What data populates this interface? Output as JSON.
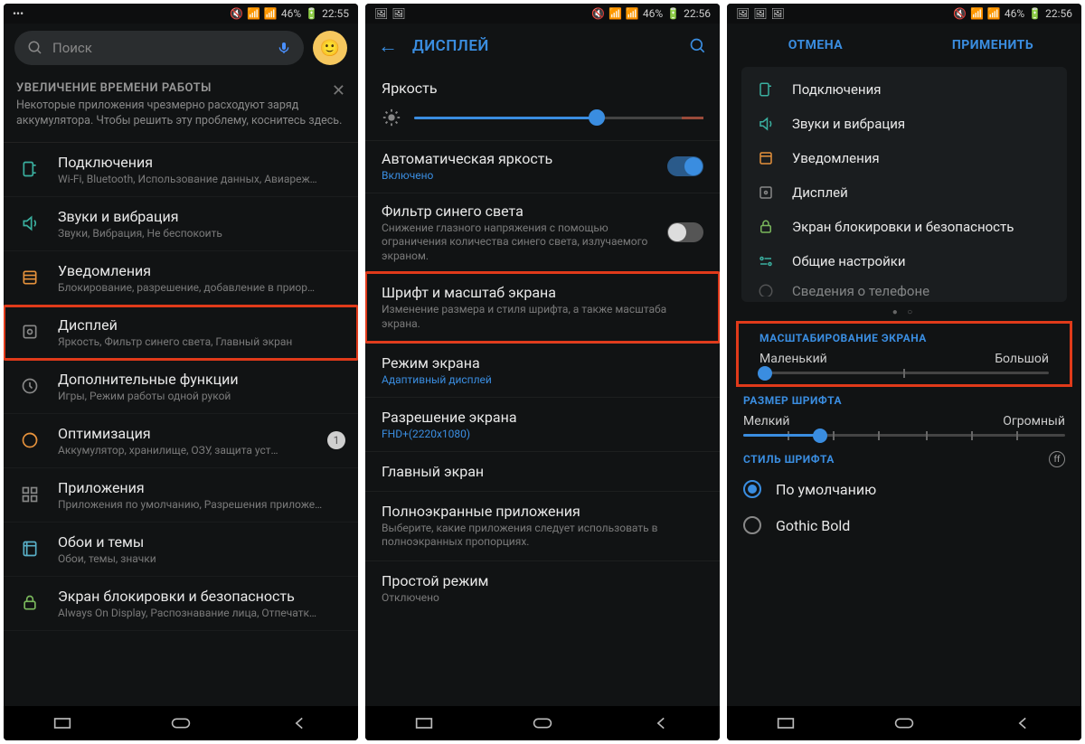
{
  "screen1": {
    "status": {
      "time": "22:55",
      "battery": "46%"
    },
    "search": {
      "placeholder": "Поиск"
    },
    "banner": {
      "title": "УВЕЛИЧЕНИЕ ВРЕМЕНИ РАБОТЫ",
      "text": "Некоторые приложения чрезмерно расходуют заряд аккумулятора. Чтобы решить эту проблему, коснитесь здесь."
    },
    "items": [
      {
        "title": "Подключения",
        "sub": "Wi-Fi, Bluetooth, Использование данных, Авиареж…"
      },
      {
        "title": "Звуки и вибрация",
        "sub": "Звуки, Вибрация, Не беспокоить"
      },
      {
        "title": "Уведомления",
        "sub": "Блокирование, разрешение, добавление в приор…"
      },
      {
        "title": "Дисплей",
        "sub": "Яркость, Фильтр синего света, Главный экран"
      },
      {
        "title": "Дополнительные функции",
        "sub": "Игры, Режим работы одной рукой"
      },
      {
        "title": "Оптимизация",
        "sub": "Аккумулятор, хранилище, ОЗУ, защита уст…",
        "badge": "1"
      },
      {
        "title": "Приложения",
        "sub": "Приложения по умолчанию, Разрешения приложе…"
      },
      {
        "title": "Обои и темы",
        "sub": "Обои, темы, значки"
      },
      {
        "title": "Экран блокировки и безопасность",
        "sub": "Always On Display, Распознавание лица, Отпечатк…"
      }
    ]
  },
  "screen2": {
    "status": {
      "time": "22:56",
      "battery": "46%"
    },
    "header": {
      "title": "ДИСПЛЕЙ"
    },
    "brightness": {
      "label": "Яркость",
      "value": 63
    },
    "rows": [
      {
        "title": "Автоматическая яркость",
        "sub": "Включено",
        "toggle": true,
        "link": true
      },
      {
        "title": "Фильтр синего света",
        "sub": "Снижение глазного напряжения с помощью ограничения количества синего света, излучаемого экраном.",
        "toggle": false
      },
      {
        "title": "Шрифт и масштаб экрана",
        "sub": "Изменение размера и стиля шрифта, а также масштаба экрана."
      },
      {
        "title": "Режим экрана",
        "sub": "Адаптивный дисплей",
        "link": true
      },
      {
        "title": "Разрешение экрана",
        "sub": "FHD+(2220x1080)",
        "link": true
      },
      {
        "title": "Главный экран"
      },
      {
        "title": "Полноэкранные приложения",
        "sub": "Выберите, какие приложения следует использовать в полноэкранных пропорциях."
      },
      {
        "title": "Простой режим",
        "sub": "Отключено"
      }
    ]
  },
  "screen3": {
    "status": {
      "time": "22:56",
      "battery": "46%"
    },
    "buttons": {
      "cancel": "ОТМЕНА",
      "apply": "ПРИМЕНИТЬ"
    },
    "quick": [
      {
        "title": "Подключения"
      },
      {
        "title": "Звуки и вибрация"
      },
      {
        "title": "Уведомления"
      },
      {
        "title": "Дисплей"
      },
      {
        "title": "Экран блокировки и безопасность"
      },
      {
        "title": "Общие настройки"
      },
      {
        "title": "Сведения о телефоне"
      }
    ],
    "sections": {
      "scale": {
        "header": "МАСШТАБИРОВАНИЕ ЭКРАНА",
        "min": "Маленький",
        "max": "Большой",
        "value": 0
      },
      "font": {
        "header": "РАЗМЕР ШРИФТА",
        "min": "Мелкий",
        "max": "Огромный",
        "value": 24
      },
      "style": {
        "header": "СТИЛЬ ШРИФТА",
        "options": [
          "По умолчанию",
          "Gothic Bold"
        ]
      }
    }
  }
}
